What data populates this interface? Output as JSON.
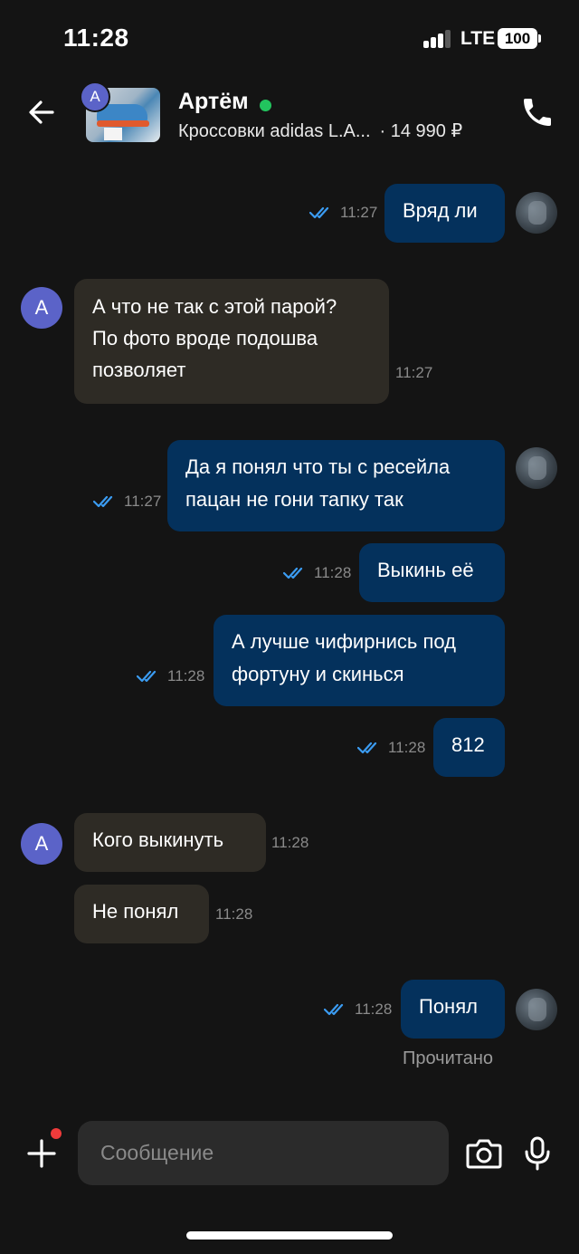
{
  "status_bar": {
    "time": "11:28",
    "network": "LTE",
    "battery": "100"
  },
  "header": {
    "contact_name": "Артём",
    "avatar_letter": "А",
    "product_title": "Кроссовки adidas L.A...",
    "product_price": "· 14 990 ₽",
    "online": true,
    "accent_online": "#22c55e"
  },
  "messages": [
    {
      "side": "out",
      "text": "Вряд ли",
      "time": "11:27"
    },
    {
      "side": "in",
      "lines": [
        "А что не так с этой парой?",
        "По фото вроде подошва",
        "позволяет"
      ],
      "time": "11:27"
    },
    {
      "side": "out",
      "lines": [
        "Да я понял что ты с ресейла",
        "пацан не гони тапку так"
      ],
      "time": "11:27"
    },
    {
      "side": "out",
      "text": "Выкинь её",
      "time": "11:28"
    },
    {
      "side": "out",
      "lines": [
        "А лучше чифирнись под",
        "фортуну и скинься"
      ],
      "time": "11:28"
    },
    {
      "side": "out",
      "text": "812",
      "time": "11:28"
    },
    {
      "side": "in",
      "text": "Кого выкинуть",
      "time": "11:28"
    },
    {
      "side": "in",
      "text": "Не понял",
      "time": "11:28"
    },
    {
      "side": "out",
      "text": "Понял",
      "time": "11:28"
    }
  ],
  "read_status": "Прочитано",
  "composer": {
    "placeholder": "Сообщение"
  },
  "colors": {
    "background": "#141414",
    "outgoing_bubble": "#04315c",
    "incoming_bubble": "#2e2b25",
    "read_check": "#3b9cf2",
    "contact_avatar": "#5b63c8"
  },
  "icons": [
    "back-arrow-icon",
    "phone-icon",
    "double-check-icon",
    "plus-icon",
    "camera-icon",
    "microphone-icon"
  ]
}
